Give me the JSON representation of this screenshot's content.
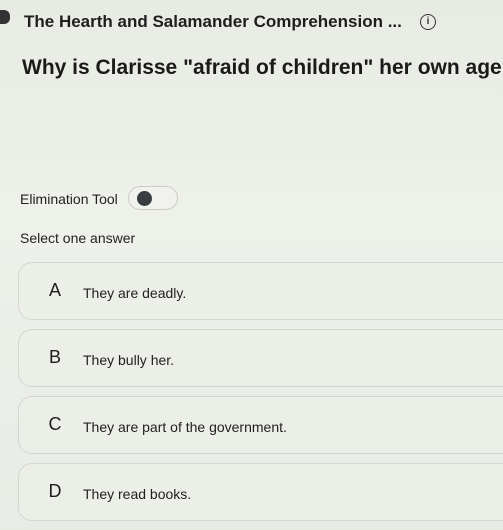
{
  "header": {
    "title": "The Hearth and Salamander Comprehension ...",
    "info_icon": "info-icon"
  },
  "question": {
    "text": "Why is Clarisse \"afraid of children\" her own age?"
  },
  "elimination_tool": {
    "label": "Elimination Tool",
    "enabled": false
  },
  "answers": {
    "prompt": "Select one answer",
    "options": [
      {
        "letter": "A",
        "text": "They are deadly."
      },
      {
        "letter": "B",
        "text": "They bully her."
      },
      {
        "letter": "C",
        "text": "They are part of the government."
      },
      {
        "letter": "D",
        "text": "They read books."
      }
    ]
  }
}
